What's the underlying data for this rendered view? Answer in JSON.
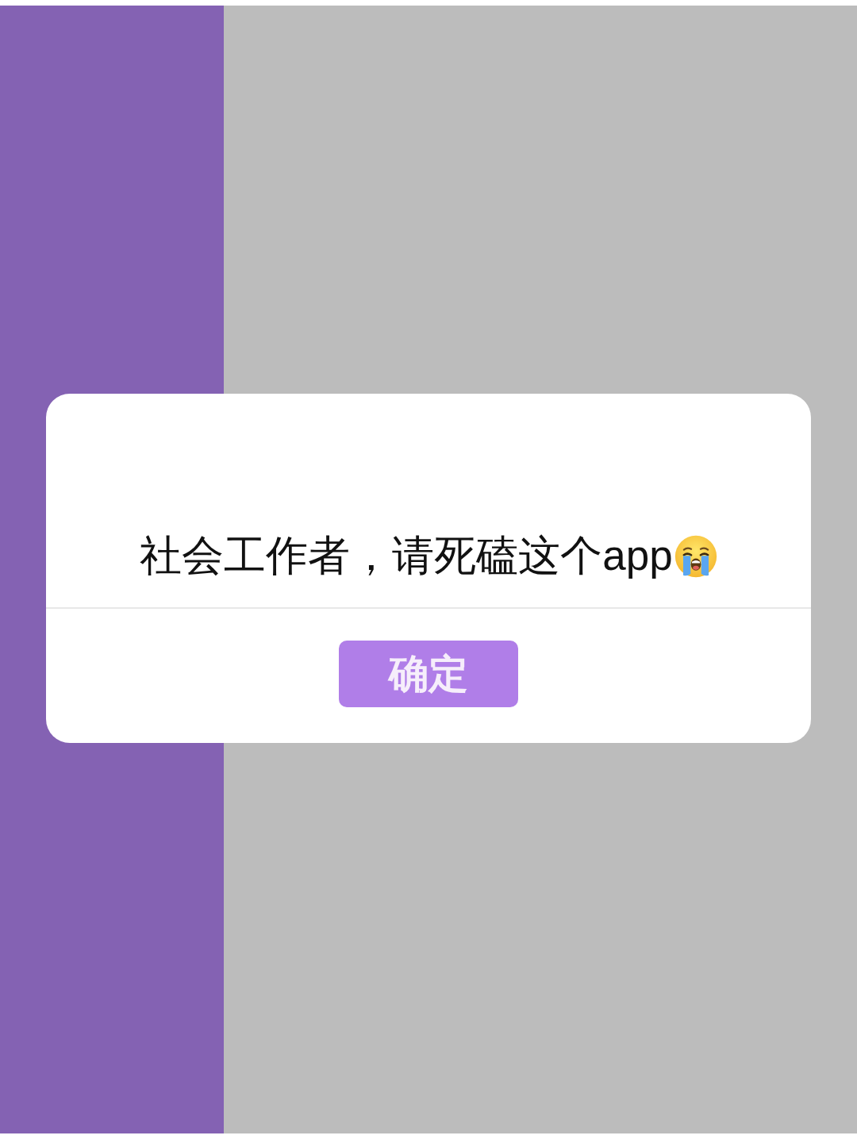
{
  "dialog": {
    "message": "社会工作者，请死磕这个app",
    "buttons": [
      {
        "label": "确定"
      }
    ]
  }
}
